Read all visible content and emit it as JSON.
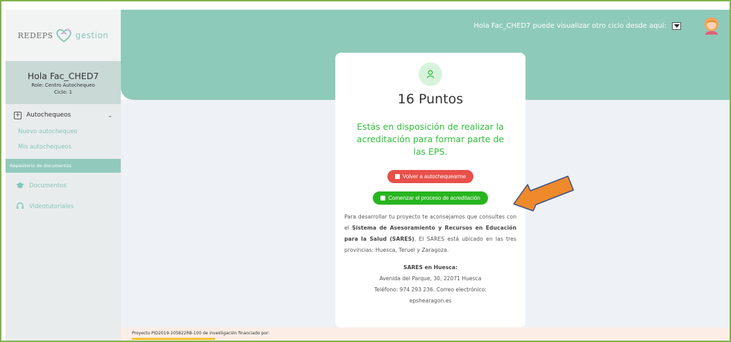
{
  "sidebar": {
    "logo_left": "REDEPS",
    "logo_right": "gestion",
    "user_name": "Hola Fac_CHED7",
    "role": "Role: Centro Autochequeo",
    "cycle": "Ciclo: 1",
    "group_label": "Autochequeos",
    "links": [
      "Nuevo autochequeo",
      "Mis autochequeos"
    ],
    "section_label": "Repositorio de documentos",
    "items": [
      {
        "label": "Documentos",
        "icon": "graduation-cap-icon"
      },
      {
        "label": "Videotutoriales",
        "icon": "headphones-icon"
      }
    ]
  },
  "header": {
    "greeting": "Hola Fac_CHED7 puede visualizar otro ciclo desde aquí:"
  },
  "card": {
    "points": "16 Puntos",
    "message": "Estás en disposición de realizar la acreditación para formar parte de las EPS.",
    "button_retry": "Volver a autochequearme",
    "button_start": "Comenzar el proceso de acreditación",
    "advice_1": "Para desarrollar tu proyecto te aconsejamos que consultes con el ",
    "advice_bold": "Sistema de Asesoramiento y Recursos en Educación para la Salud (SARES)",
    "advice_2": ". El SARES está ubicado en las tres provincias: Huesca, Teruel y Zaragoza.",
    "addr_title": "SARES en Huesca:",
    "addr_street": "Avenida del Parque, 30, 22071 Huesca",
    "addr_phone": "Teléfono: 974 293 236. Correo electrónico:",
    "addr_email": "epshearagon.es"
  },
  "footer": {
    "text": "Proyecto PID2019-105822RB-100 de investigación financiado por:"
  },
  "colors": {
    "header": "#8ecab9",
    "accent_green": "#2fbf3a",
    "button_red": "#e8504a",
    "button_green": "#27b51f",
    "arrow": "#ef8a2c"
  }
}
